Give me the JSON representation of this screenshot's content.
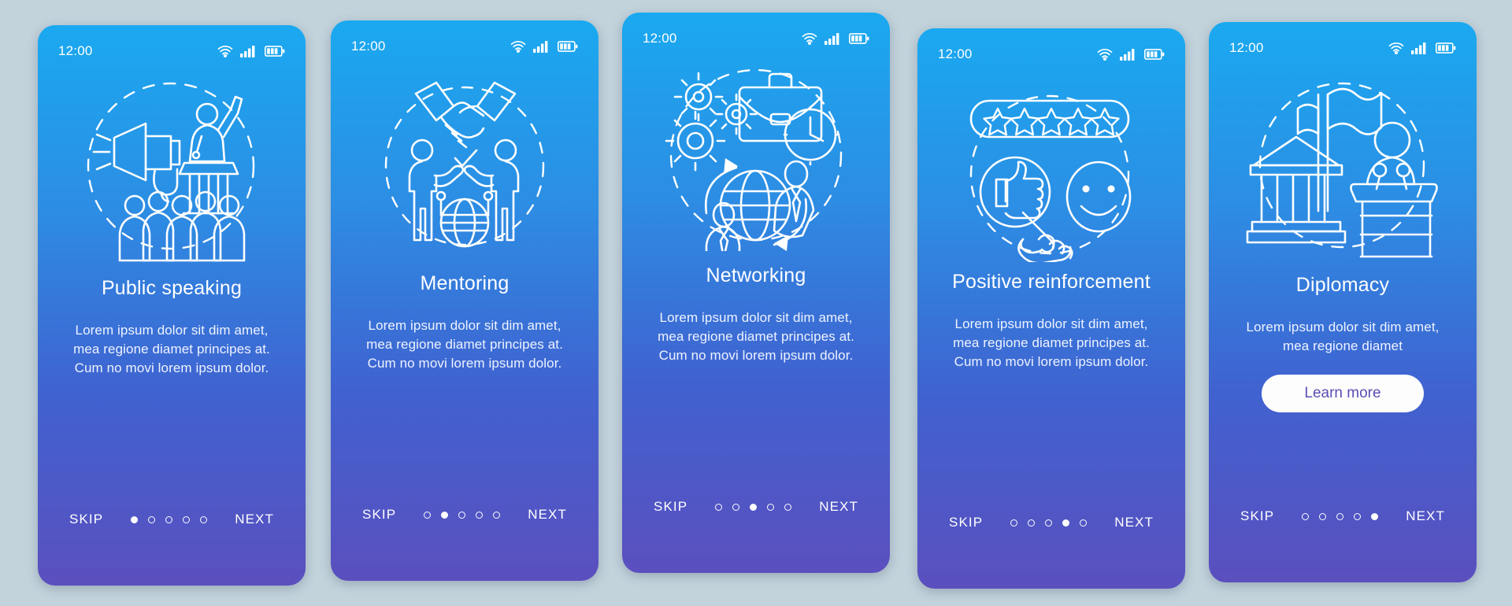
{
  "screens": [
    {
      "status": {
        "time": "12:00",
        "wifi_icon": "wifi-icon",
        "signal_icon": "signal-bars-icon",
        "battery_icon": "battery-icon"
      },
      "illustration": "public-speaking-illustration",
      "title": "Public speaking",
      "body": "Lorem ipsum dolor sit dim amet, mea regione diamet principes at. Cum no movi lorem ipsum dolor.",
      "skip_label": "SKIP",
      "next_label": "NEXT",
      "dots_total": 5,
      "dots_active": 1,
      "cta_label": null
    },
    {
      "status": {
        "time": "12:00",
        "wifi_icon": "wifi-icon",
        "signal_icon": "signal-bars-icon",
        "battery_icon": "battery-icon"
      },
      "illustration": "mentoring-illustration",
      "title": "Mentoring",
      "body": "Lorem ipsum dolor sit dim amet, mea regione diamet principes at. Cum no movi lorem ipsum dolor.",
      "skip_label": "SKIP",
      "next_label": "NEXT",
      "dots_total": 5,
      "dots_active": 2,
      "cta_label": null
    },
    {
      "status": {
        "time": "12:00",
        "wifi_icon": "wifi-icon",
        "signal_icon": "signal-bars-icon",
        "battery_icon": "battery-icon"
      },
      "illustration": "networking-illustration",
      "title": "Networking",
      "body": "Lorem ipsum dolor sit dim amet, mea regione diamet principes at. Cum no movi lorem ipsum dolor.",
      "skip_label": "SKIP",
      "next_label": "NEXT",
      "dots_total": 5,
      "dots_active": 3,
      "cta_label": null
    },
    {
      "status": {
        "time": "12:00",
        "wifi_icon": "wifi-icon",
        "signal_icon": "signal-bars-icon",
        "battery_icon": "battery-icon"
      },
      "illustration": "positive-reinforcement-illustration",
      "title": "Positive reinforcement",
      "body": "Lorem ipsum dolor sit dim amet, mea regione diamet principes at. Cum no movi lorem ipsum dolor.",
      "skip_label": "SKIP",
      "next_label": "NEXT",
      "dots_total": 5,
      "dots_active": 4,
      "cta_label": null
    },
    {
      "status": {
        "time": "12:00",
        "wifi_icon": "wifi-icon",
        "signal_icon": "signal-bars-icon",
        "battery_icon": "battery-icon"
      },
      "illustration": "diplomacy-illustration",
      "title": "Diplomacy",
      "body": "Lorem ipsum dolor sit dim amet, mea regione diamet",
      "skip_label": "SKIP",
      "next_label": "NEXT",
      "dots_total": 5,
      "dots_active": 5,
      "cta_label": "Learn more"
    }
  ],
  "colors": {
    "page_background": "#c3d3dc",
    "gradient_top": "#1aa9f0",
    "gradient_bottom": "#5b4fbe",
    "line_art": "#ffffff",
    "cta_background": "#fdfdfd",
    "cta_text": "#5a4fb5"
  }
}
